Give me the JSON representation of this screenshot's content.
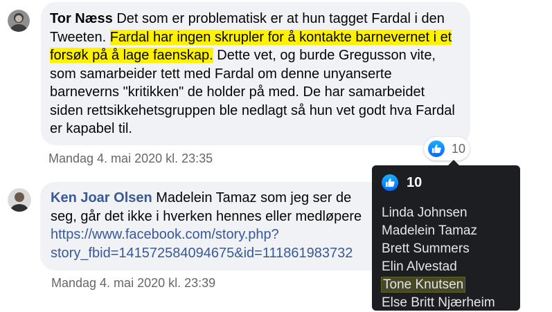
{
  "comments": [
    {
      "author": "Tor Næss",
      "text_before": " Det som er problematisk er at hun tagget Fardal i den Tweeten. ",
      "text_highlight": "Fardal har ingen skrupler for å kontakte barnevernet i et forsøk på å lage faenskap.",
      "text_after": " Dette vet, og burde Gregusson vite, som samarbeider tett med Fardal om denne unyanserte barneverns \"kritikken\" de holder på med. De har samarbeidet siden rettsikkehetsgruppen ble nedlagt så hun vet godt hva Fardal er kapabel til.",
      "timestamp": "Mandag 4. mai 2020 kl. 23:35",
      "reaction_count": "10"
    },
    {
      "author": "Ken Joar Olsen",
      "text": " Madelein Tamaz som jeg ser de",
      "text_line2": "seg, går det ikke i hverken hennes eller medløpere",
      "link_line1": "https://www.facebook.com/story.php?",
      "link_line2": "story_fbid=141572584094675&id=111861983732",
      "timestamp": "Mandag 4. mai 2020 kl. 23:39"
    }
  ],
  "tooltip": {
    "count": "10",
    "names": [
      "Linda Johnsen",
      "Madelein Tamaz",
      "Brett Summers",
      "Elin Alvestad",
      "Tone Knutsen",
      "Else Britt Njærheim"
    ]
  },
  "icons": {
    "reaction": "like-icon",
    "avatar": "person-avatar"
  },
  "colors": {
    "like": "#1877f2",
    "highlight": "#fff200",
    "link": "#385898",
    "tooltip_bg": "#1c1e21"
  }
}
